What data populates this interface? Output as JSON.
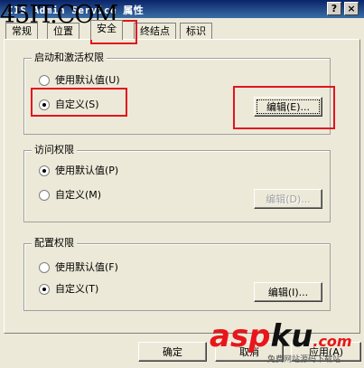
{
  "window": {
    "title": "IIS Admin Service 属性",
    "help_label": "?",
    "close_label": "×"
  },
  "watermark": {
    "top_text": "45IT.COM",
    "brand_red": "asp",
    "brand_black": "ku",
    "brand_suffix": ".com",
    "subtitle": "免费网站源码下载站"
  },
  "tabs": [
    {
      "label": "常规"
    },
    {
      "label": "位置"
    },
    {
      "label": "安全"
    },
    {
      "label": "终结点"
    },
    {
      "label": "标识"
    }
  ],
  "active_tab": "安全",
  "groups": {
    "launch": {
      "title": "启动和激活权限",
      "option_default": "使用默认值(U)",
      "option_custom": "自定义(S)",
      "selected": "custom",
      "edit_label": "编辑(E)...",
      "edit_enabled": true
    },
    "access": {
      "title": "访问权限",
      "option_default": "使用默认值(P)",
      "option_custom": "自定义(M)",
      "selected": "default",
      "edit_label": "编辑(D)...",
      "edit_enabled": false
    },
    "config": {
      "title": "配置权限",
      "option_default": "使用默认值(F)",
      "option_custom": "自定义(T)",
      "selected": "custom",
      "edit_label": "编辑(I)...",
      "edit_enabled": true
    }
  },
  "buttons": {
    "ok": "确定",
    "cancel": "取消",
    "apply": "应用(A)"
  },
  "colors": {
    "highlight": "#e0151f",
    "titlebar": "#0a246a",
    "dialog_bg": "#ece9d8"
  }
}
